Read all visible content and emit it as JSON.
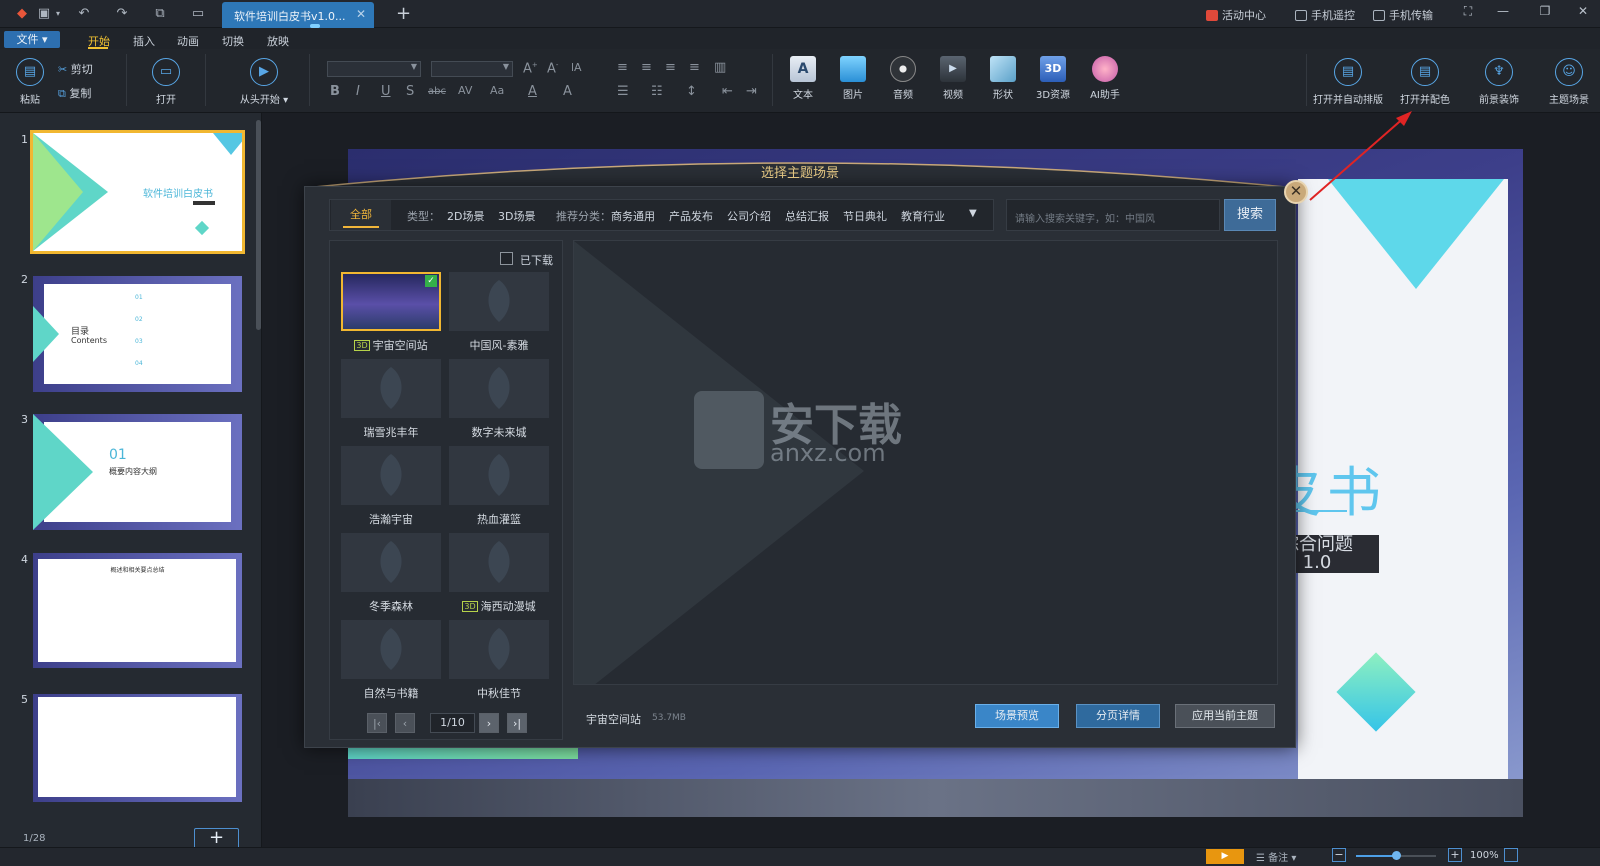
{
  "titlebar": {
    "doc_tab": "软件培训白皮书v1.0...",
    "right_items": [
      "活动中心",
      "手机遥控",
      "手机传输"
    ]
  },
  "menu": {
    "file": "文件",
    "items": [
      "开始",
      "插入",
      "动画",
      "切换",
      "放映"
    ]
  },
  "ribbon": {
    "paste": "粘贴",
    "cut": "剪切",
    "copy": "复制",
    "open": "打开",
    "from_start": "从头开始",
    "insert": [
      "文本",
      "图片",
      "音频",
      "视频",
      "形状",
      "3D资源",
      "AI助手"
    ],
    "right": [
      "打开并自动排版",
      "打开并配色",
      "前景装饰",
      "主题场景"
    ]
  },
  "slides": {
    "numbers": [
      "1",
      "2",
      "3",
      "4",
      "5"
    ],
    "s1_title": "软件培训白皮书",
    "s2_heading": "目录",
    "s2_sub": "Contents",
    "s2_items": [
      "01",
      "02",
      "03",
      "04"
    ],
    "s3_num": "01",
    "s3_title": "概要内容大纲",
    "s4_title": "概述和相关要点总结",
    "counter": "1/28",
    "add": "+"
  },
  "canvas": {
    "title": "软件培训白皮书",
    "subtitle_line1": "综合问题",
    "subtitle_line2": "1.0"
  },
  "dialog": {
    "title": "选择主题场景",
    "filter_all": "全部",
    "type_label": "类型：",
    "types": [
      "2D场景",
      "3D场景"
    ],
    "rec_label": "推荐分类：",
    "categories": [
      "商务通用",
      "产品发布",
      "公司介绍",
      "总结汇报",
      "节日典礼",
      "教育行业"
    ],
    "search_placeholder": "请输入搜索关键字，如：中国风",
    "search_button": "搜索",
    "downloaded_label": "已下载",
    "themes": [
      "宇宙空间站",
      "中国风-素雅",
      "瑞雪兆丰年",
      "数字未来城",
      "浩瀚宇宙",
      "热血灌篮",
      "冬季森林",
      "海西动漫城",
      "自然与书籍",
      "中秋佳节"
    ],
    "badge_3d": "3D",
    "page_indicator": "1/10",
    "selected_name": "宇宙空间站",
    "selected_size": "53.7MB",
    "btn_preview": "场景预览",
    "btn_detail": "分页详情",
    "btn_apply": "应用当前主题"
  },
  "watermark": {
    "text_cn": "安下载",
    "text_en": "anxz.com"
  },
  "statusbar": {
    "notes": "备注",
    "zoom": "100%"
  },
  "colors": {
    "accent_blue": "#2e78b8",
    "accent_orange": "#f1b731",
    "dialog_title": "#e3c682",
    "slide_cyan": "#5fc6ee"
  }
}
